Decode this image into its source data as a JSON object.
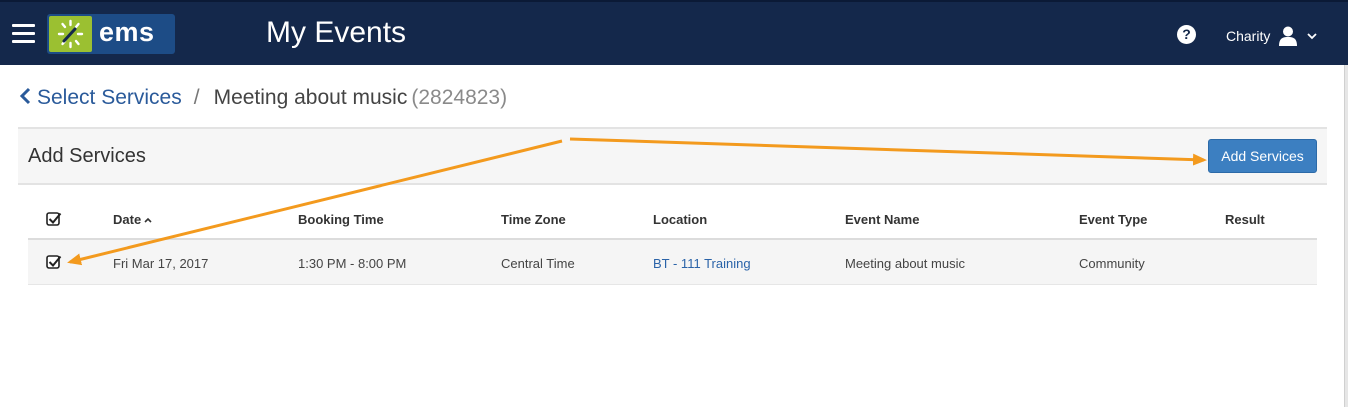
{
  "header": {
    "logo_text": "ems",
    "title": "My Events",
    "help_icon": "question-circle-icon",
    "user_name": "Charity",
    "user_icon": "user-icon",
    "menu_icon": "hamburger-icon",
    "colors": {
      "bar": "#14284b",
      "logo_bg": "#1d4c86",
      "logo_mark": "#9bc031"
    }
  },
  "breadcrumb": {
    "back_label": "Select Services",
    "separator": "/",
    "current": "Meeting about music",
    "id": "(2824823)"
  },
  "panel": {
    "title": "Add Services",
    "add_button_label": "Add Services"
  },
  "table": {
    "columns": [
      "Date",
      "Booking Time",
      "Time Zone",
      "Location",
      "Event Name",
      "Event Type",
      "Result"
    ],
    "sort_column": "Date",
    "select_all_checked": true,
    "rows": [
      {
        "checked": true,
        "date": "Fri Mar 17, 2017",
        "booking_time": "1:30 PM - 8:00 PM",
        "time_zone": "Central Time",
        "location": "BT - 111 Training",
        "event_name": "Meeting about music",
        "event_type": "Community",
        "result": ""
      }
    ]
  },
  "annotation_color": "#f39a1e"
}
